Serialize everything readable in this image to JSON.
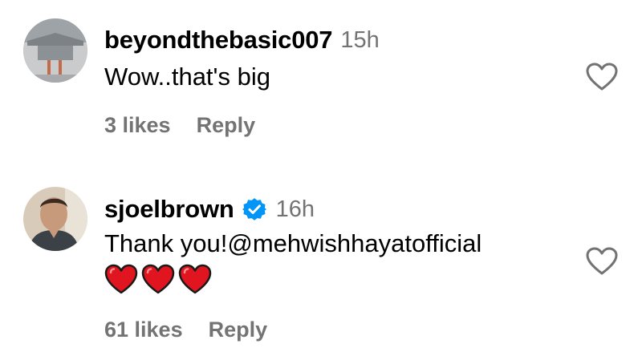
{
  "comments": [
    {
      "username": "beyondthebasic007",
      "timestamp": "15h",
      "text": "Wow..that's big",
      "likes_label": "3 likes",
      "reply_label": "Reply",
      "avatar_icon": "avatar-photo-aircraft-hangar",
      "like_icon": "heart-outline-icon"
    },
    {
      "username": "sjoelbrown",
      "verified": true,
      "verified_icon": "verified-badge-icon",
      "verified_color": "#0095f6",
      "timestamp": "16h",
      "text": "Thank you!@mehwishhayatofficial",
      "emojis": [
        "❤️",
        "❤️",
        "❤️"
      ],
      "likes_label": "61 likes",
      "reply_label": "Reply",
      "avatar_icon": "avatar-photo-man",
      "like_icon": "heart-outline-icon"
    }
  ],
  "colors": {
    "text_primary": "#000000",
    "text_secondary": "#737373",
    "heart_emoji": "#e0151f"
  }
}
